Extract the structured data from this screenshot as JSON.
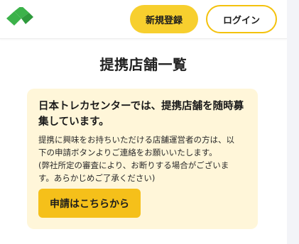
{
  "header": {
    "logo_icon": "green-diamond-logo-icon",
    "register_label": "新規登録",
    "login_label": "ログイン"
  },
  "main": {
    "title": "提携店舗一覧",
    "notice": {
      "heading_line1": "日本トレカセンターでは、提携店舗を随時募",
      "heading_line2": "集しています。",
      "body_lines": [
        "提携に興味をお持ちいただける店舗運営者の方は、以",
        "下の申請ボタンよりご連絡をお願いいたします。",
        "(弊社所定の審査により、お断りする場合がございま",
        "す。あらかじめご了承ください)"
      ],
      "apply_label": "申請はこちらから"
    }
  },
  "colors": {
    "accent_yellow": "#f7cf2e",
    "notice_background": "#fff6d9",
    "logo_green": "#3cb24a"
  }
}
